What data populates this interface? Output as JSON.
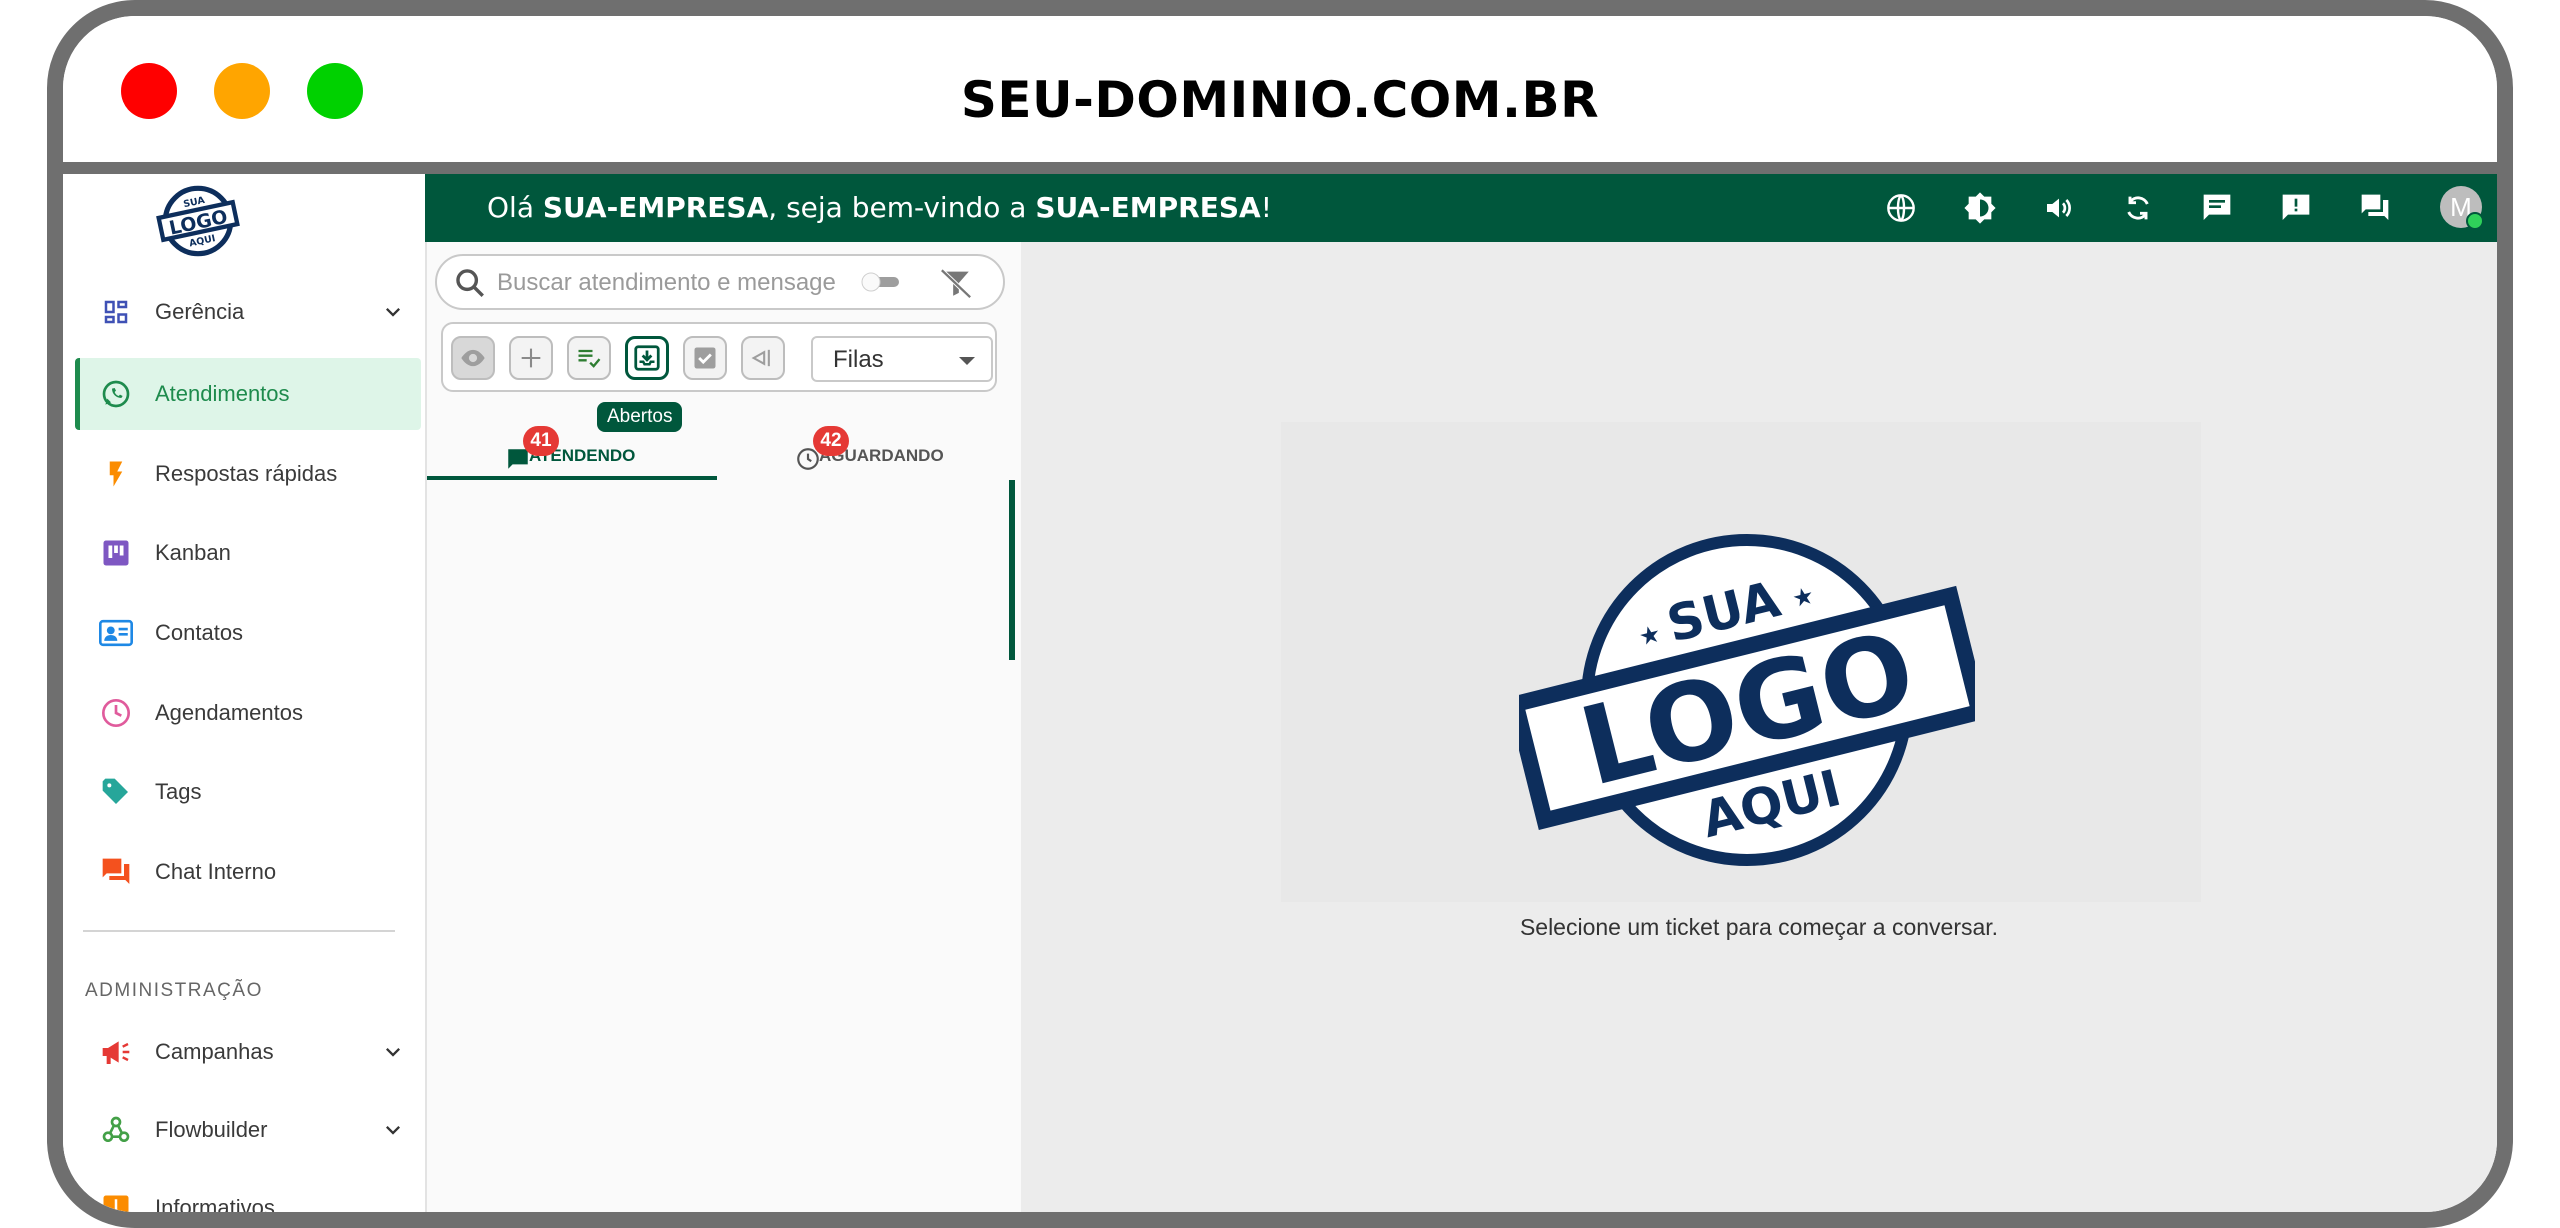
{
  "browser": {
    "domain": "SEU-DOMINIO.COM.BR"
  },
  "logo": {
    "top": "SUA",
    "middle": "LOGO",
    "bottom": "AQUI"
  },
  "topbar": {
    "greeting_prefix": "Olá ",
    "company": "SUA-EMPRESA",
    "greeting_middle": ", seja bem-vindo a ",
    "company2": "SUA-EMPRESA",
    "greeting_suffix": "!",
    "avatar_initial": "M",
    "icons": [
      "globe-icon",
      "brightness-icon",
      "volume-icon",
      "sync-icon",
      "chat-icon",
      "feedback-icon",
      "forum-icon"
    ]
  },
  "sidebar": {
    "items": [
      {
        "label": "Gerência",
        "icon": "dashboard-icon"
      },
      {
        "label": "Atendimentos",
        "icon": "whatsapp-icon"
      },
      {
        "label": "Respostas rápidas",
        "icon": "flash-icon"
      },
      {
        "label": "Kanban",
        "icon": "kanban-icon"
      },
      {
        "label": "Contatos",
        "icon": "contacts-icon"
      },
      {
        "label": "Agendamentos",
        "icon": "clock-icon"
      },
      {
        "label": "Tags",
        "icon": "tag-icon"
      },
      {
        "label": "Chat Interno",
        "icon": "chat-icon"
      }
    ],
    "section_title": "ADMINISTRAÇÃO",
    "admin_items": [
      {
        "label": "Campanhas",
        "icon": "megaphone-icon"
      },
      {
        "label": "Flowbuilder",
        "icon": "webhook-icon"
      },
      {
        "label": "Informativos",
        "icon": "announcement-icon"
      }
    ],
    "colors": {
      "active_bg": "#def5e8",
      "active_fg": "#1e8b4d"
    }
  },
  "tickets": {
    "search_placeholder": "Buscar atendimento e mensagens",
    "queue_select": "Filas",
    "tooltip": "Abertos",
    "tabs": [
      {
        "label": "ATENDENDO",
        "badge": "41"
      },
      {
        "label": "AGUARDANDO",
        "badge": "42"
      }
    ]
  },
  "main": {
    "empty_message": "Selecione um ticket para começar a conversar."
  },
  "colors": {
    "brand": "#00573c",
    "badge": "#e53935",
    "logo": "#0d2e5c"
  }
}
